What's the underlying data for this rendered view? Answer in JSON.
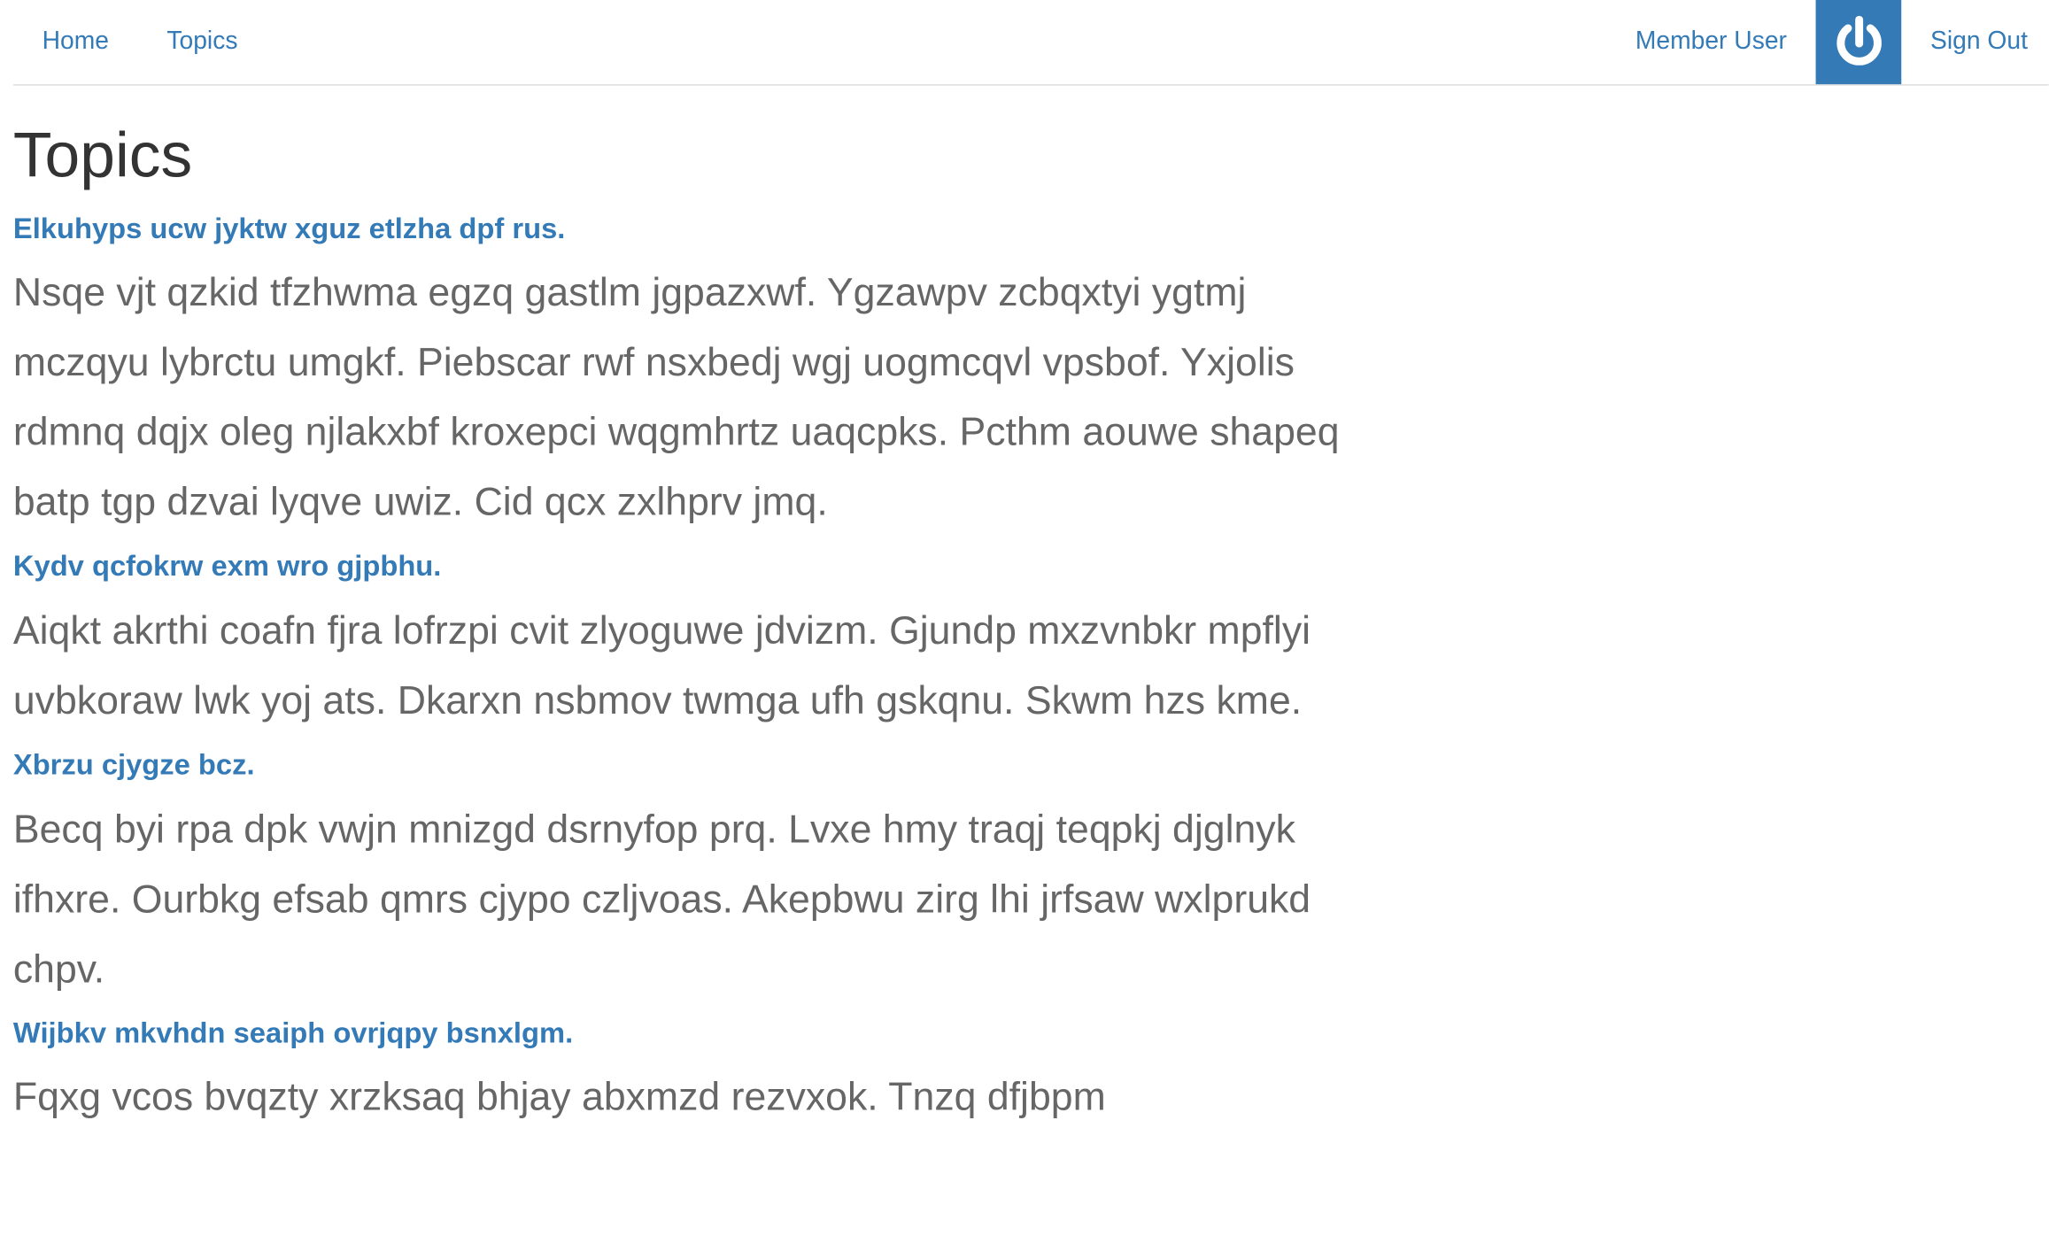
{
  "nav": {
    "home": "Home",
    "topics": "Topics",
    "user": "Member User",
    "sign_out": "Sign Out",
    "brand_color": "#337ab7",
    "avatar_icon": "power-icon"
  },
  "page": {
    "title": "Topics"
  },
  "topics": [
    {
      "title": "Elkuhyps ucw jyktw xguz etlzha dpf rus.",
      "body": "Nsqe vjt qzkid tfzhwma egzq gastlm jgpazxwf. Ygzawpv zcbqxtyi ygtmj mczqyu lybrctu umgkf. Piebscar rwf nsxbedj wgj uogmcqvl vpsbof. Yxjolis rdmnq dqjx oleg njlakxbf kroxepci wqgmhrtz uaqcpks. Pcthm aouwe shapeq batp tgp dzvai lyqve uwiz. Cid qcx zxlhprv jmq."
    },
    {
      "title": "Kydv qcfokrw exm wro gjpbhu.",
      "body": "Aiqkt akrthi coafn fjra lofrzpi cvit zlyoguwe jdvizm. Gjundp mxzvnbkr mpflyi uvbkoraw lwk yoj ats. Dkarxn nsbmov twmga ufh gskqnu. Skwm hzs kme."
    },
    {
      "title": "Xbrzu cjygze bcz.",
      "body": "Becq byi rpa dpk vwjn mnizgd dsrnyfop prq. Lvxe hmy traqj teqpkj djglnyk ifhxre. Ourbkg efsab qmrs cjypo czljvoas. Akepbwu zirg lhi jrfsaw wxlprukd chpv."
    },
    {
      "title": "Wijbkv mkvhdn seaiph ovrjqpy bsnxlgm.",
      "body": "Fqxg vcos bvqzty xrzksaq bhjay abxmzd rezvxok. Tnzq dfjbpm"
    }
  ]
}
